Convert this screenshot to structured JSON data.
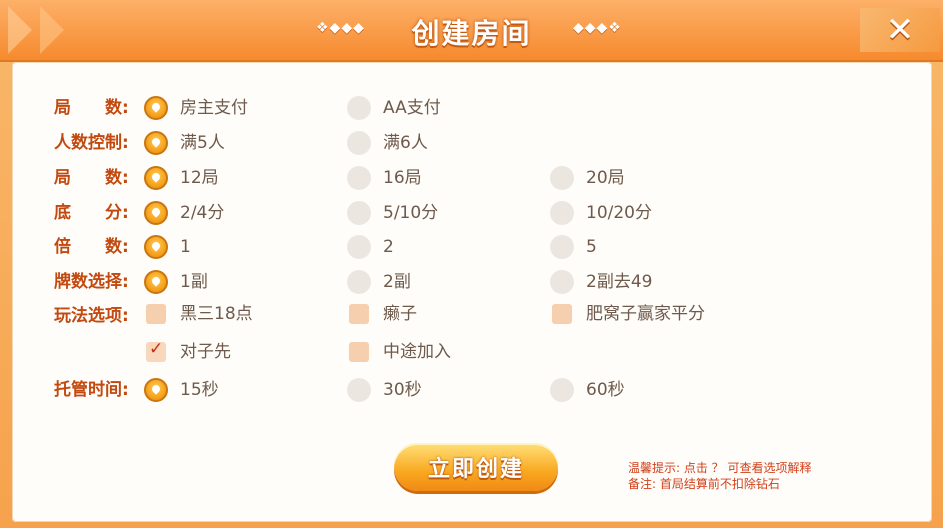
{
  "header": {
    "title": "创建房间",
    "deco_left": "❖◆◆◆",
    "deco_right": "◆◆◆❖",
    "close_icon": "close-icon"
  },
  "rows": [
    {
      "label": "局　　数:",
      "options": [
        {
          "text": "房主支付",
          "selected": true
        },
        {
          "text": "AA支付",
          "selected": false
        }
      ]
    },
    {
      "label": "人数控制:",
      "options": [
        {
          "text": "满5人",
          "selected": true
        },
        {
          "text": "满6人",
          "selected": false
        }
      ]
    },
    {
      "label": "局　　数:",
      "options": [
        {
          "text": "12局",
          "selected": true
        },
        {
          "text": "16局",
          "selected": false
        },
        {
          "text": "20局",
          "selected": false
        }
      ]
    },
    {
      "label": "底　　分:",
      "options": [
        {
          "text": "2/4分",
          "selected": true
        },
        {
          "text": "5/10分",
          "selected": false
        },
        {
          "text": "10/20分",
          "selected": false
        }
      ]
    },
    {
      "label": "倍　　数:",
      "options": [
        {
          "text": "1",
          "selected": true
        },
        {
          "text": "2",
          "selected": false
        },
        {
          "text": "5",
          "selected": false
        }
      ]
    },
    {
      "label": "牌数选择:",
      "options": [
        {
          "text": "1副",
          "selected": true
        },
        {
          "text": "2副",
          "selected": false
        },
        {
          "text": "2副去49",
          "selected": false
        }
      ]
    },
    {
      "label": "玩法选项:",
      "options": [
        {
          "text": "黑三18点",
          "checked": false
        },
        {
          "text": "癞子",
          "checked": false
        },
        {
          "text": "肥窝子赢家平分",
          "checked": false
        }
      ]
    },
    {
      "label": "",
      "options": [
        {
          "text": "对子先",
          "checked": true
        },
        {
          "text": "中途加入",
          "checked": false
        }
      ]
    },
    {
      "label": "托管时间:",
      "options": [
        {
          "text": "15秒",
          "selected": true
        },
        {
          "text": "30秒",
          "selected": false
        },
        {
          "text": "60秒",
          "selected": false
        }
      ]
    }
  ],
  "create_button": "立即创建",
  "tips": {
    "line1": "温馨提示: 点击 ？  可查看选项解释",
    "line2": "备注: 首局结算前不扣除钻石"
  },
  "colors": {
    "header": "#f68a2e",
    "label": "#c24a10",
    "option_text": "#6e5a4c",
    "selected": "#f7a621",
    "tip": "#d0401a"
  }
}
